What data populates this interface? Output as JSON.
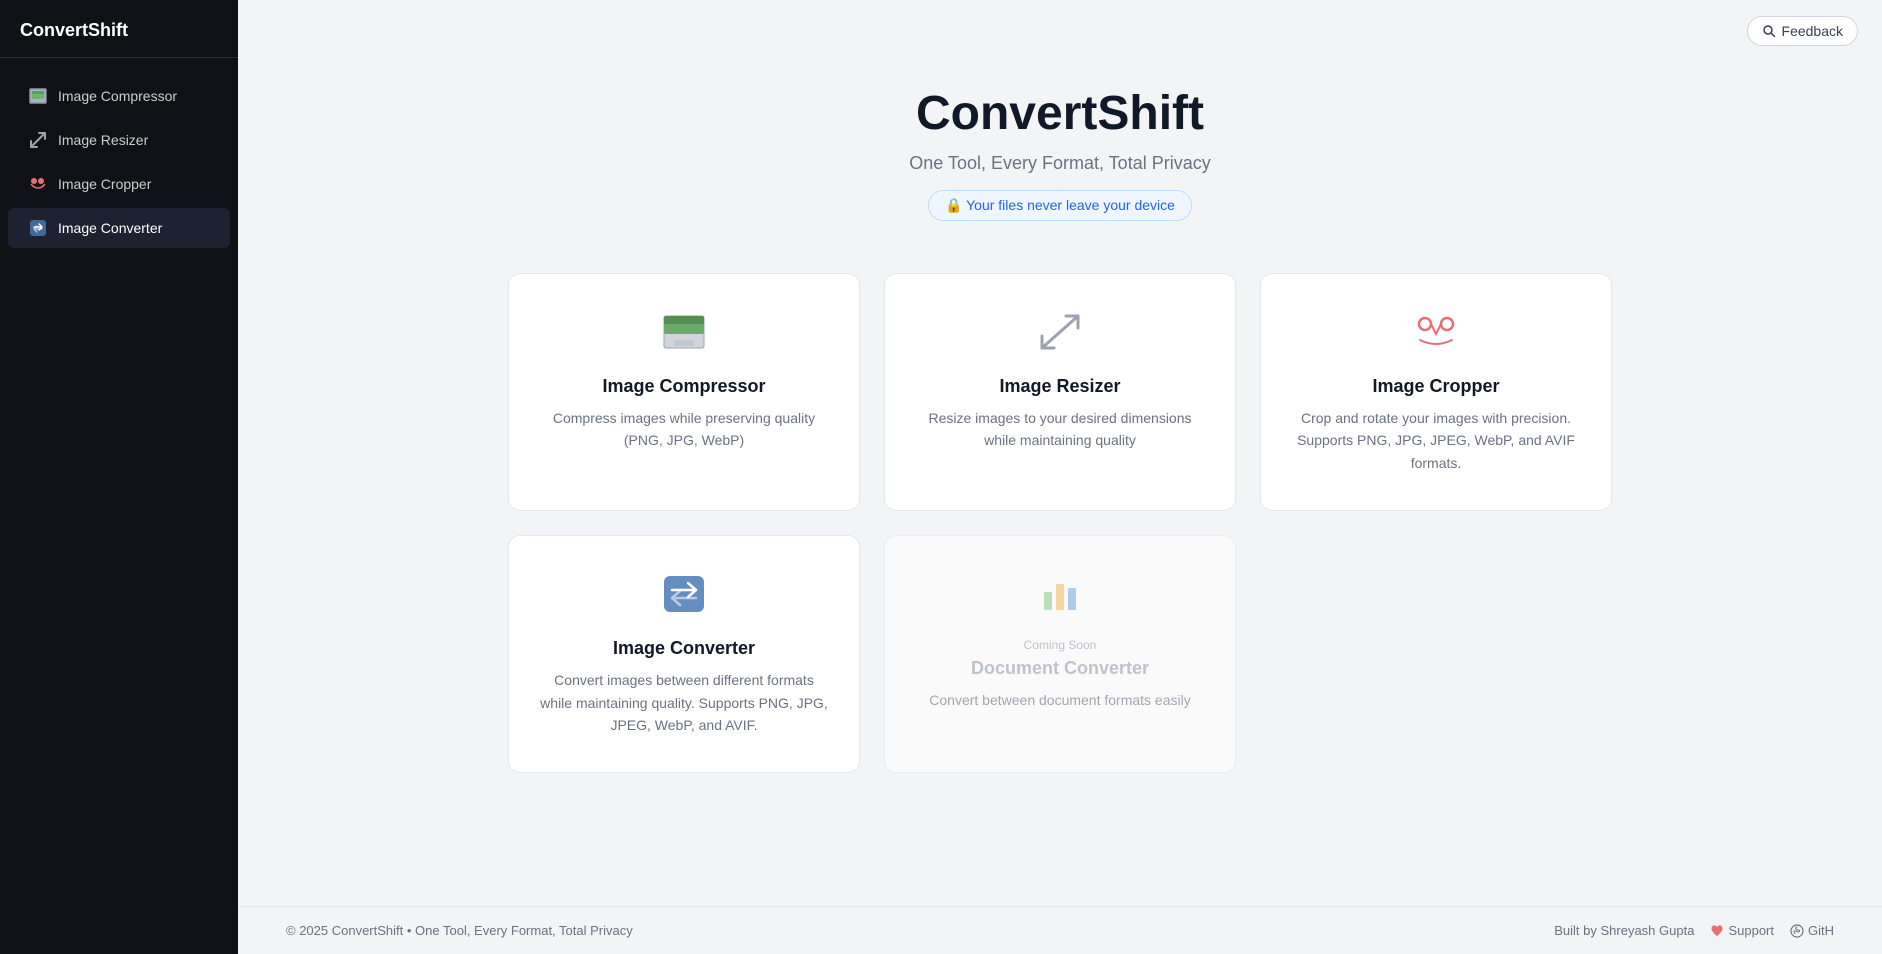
{
  "app": {
    "name": "ConvertShift"
  },
  "sidebar": {
    "logo": "ConvertShift",
    "items": [
      {
        "id": "image-compressor",
        "label": "Image Compressor",
        "icon": "compress-icon"
      },
      {
        "id": "image-resizer",
        "label": "Image Resizer",
        "icon": "resize-icon"
      },
      {
        "id": "image-cropper",
        "label": "Image Cropper",
        "icon": "crop-icon"
      },
      {
        "id": "image-converter",
        "label": "Image Converter",
        "icon": "convert-icon",
        "active": true
      }
    ]
  },
  "header": {
    "feedback_label": "Feedback"
  },
  "hero": {
    "title": "ConvertShift",
    "subtitle": "One Tool, Every Format, Total Privacy",
    "privacy_badge": "🔒 Your files never leave your device"
  },
  "cards": [
    {
      "id": "image-compressor",
      "title": "Image Compressor",
      "desc": "Compress images while preserving quality (PNG, JPG, WebP)",
      "icon": "compress",
      "disabled": false
    },
    {
      "id": "image-resizer",
      "title": "Image Resizer",
      "desc": "Resize images to your desired dimensions while maintaining quality",
      "icon": "resize",
      "disabled": false
    },
    {
      "id": "image-cropper",
      "title": "Image Cropper",
      "desc": "Crop and rotate your images with precision. Supports PNG, JPG, JPEG, WebP, and AVIF formats.",
      "icon": "crop",
      "disabled": false
    },
    {
      "id": "image-converter",
      "title": "Image Converter",
      "desc": "Convert images between different formats while maintaining quality. Supports PNG, JPG, JPEG, WebP, and AVIF.",
      "icon": "convert",
      "disabled": false
    },
    {
      "id": "document-converter",
      "title": "Document Converter",
      "desc": "Convert between document formats easily",
      "coming_soon": "Coming Soon",
      "icon": "doc",
      "disabled": true
    }
  ],
  "footer": {
    "copyright": "© 2025 ConvertShift • One Tool, Every Format, Total Privacy",
    "built_by": "Built by Shreyash Gupta",
    "support": "Support",
    "github": "GitH"
  }
}
